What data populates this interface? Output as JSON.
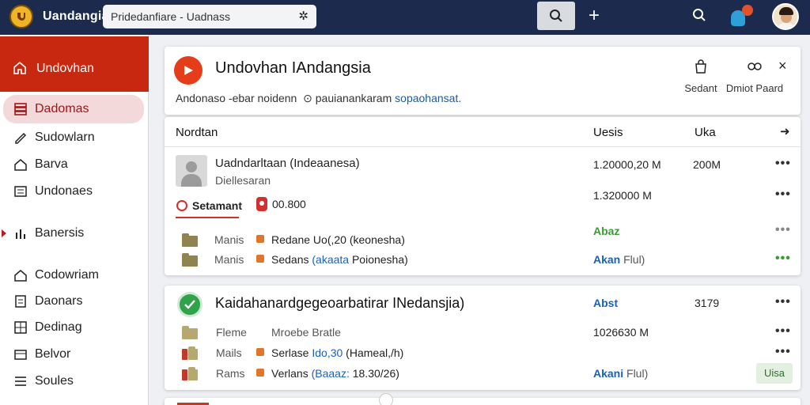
{
  "topbar": {
    "brand": "Uandangia",
    "search_value": "Pridedanfiare - Uadnass",
    "icons": [
      "logo-icon",
      "star-icon",
      "search-icon",
      "plus-icon",
      "search-icon",
      "notification-icon",
      "avatar"
    ]
  },
  "sidebar": {
    "header": "Undovhan",
    "items": [
      {
        "label": "Dadomas",
        "icon": "stack-icon",
        "active": true
      },
      {
        "label": "Sudowlarn",
        "icon": "pen-icon"
      },
      {
        "label": "Barva",
        "icon": "home-icon"
      },
      {
        "label": "Undonaes",
        "icon": "list-icon"
      },
      {
        "label": "Banersis",
        "icon": "bar-chart-icon"
      },
      {
        "label": "Codowriam",
        "icon": "home-icon"
      },
      {
        "label": "Daonars",
        "icon": "document-icon"
      },
      {
        "label": "Dedinag",
        "icon": "grid-icon"
      },
      {
        "label": "Belvor",
        "icon": "box-icon"
      },
      {
        "label": "Soules",
        "icon": "list-icon"
      }
    ]
  },
  "header": {
    "title": "Undovhan IAndangsia",
    "subtitle_prefix": "Andonaso  -ebar noidenn",
    "subtitle_mid": "pauianankaram",
    "subtitle_link": "sopaohansat.",
    "actions": [
      {
        "label": "Sedant",
        "icon": "bag-icon"
      },
      {
        "label": "Dmiot Paard",
        "icon": "link-icon"
      }
    ],
    "close": "×"
  },
  "table": {
    "columns": [
      "Nordtan",
      "Uesis",
      "Uka"
    ],
    "arrow": "➜",
    "record": {
      "name": "Uadndarltaan (Indeaanesa)",
      "sub": "Diellesaran",
      "status_label": "Setamant",
      "status_value": "00.800",
      "value1": "1.20000,20 M",
      "value1_extra": "200M",
      "value2": "1.320000 M",
      "badge": "Abaz",
      "lines": [
        {
          "kind": "Manis",
          "item": "Redane Uo(,20 (keonesha)",
          "status_prefix": "",
          "status_blue": "",
          "status_tail": ""
        },
        {
          "kind": "Manis",
          "item_prefix": "Sedans ",
          "item_blue": "(akaata",
          "item_tail": " Poionesha)",
          "status_blue": "Akan",
          "status_tail": " Flul)"
        }
      ]
    }
  },
  "entry": {
    "title": "Kaidahanardgegeoarbatirar INedansjia)",
    "col_label": "Abst",
    "col_value": "3179",
    "line1_kind": "Fleme",
    "line1_item": "Mroebe Bratle",
    "line1_value": "1026630 M",
    "line2_kind": "Mails",
    "line2_item_prefix": "Serlase ",
    "line2_item_blue": "Ido,30",
    "line2_item_tail": " (Hameal,/h)",
    "line3_kind": "Rams",
    "line3_item_prefix": "Verlans ",
    "line3_item_blue": "(Baaaz:",
    "line3_item_tail": " 18.30/26)",
    "line3_status_blue": "Akani",
    "line3_status_tail": " Flul)",
    "tag": "Uisa"
  }
}
